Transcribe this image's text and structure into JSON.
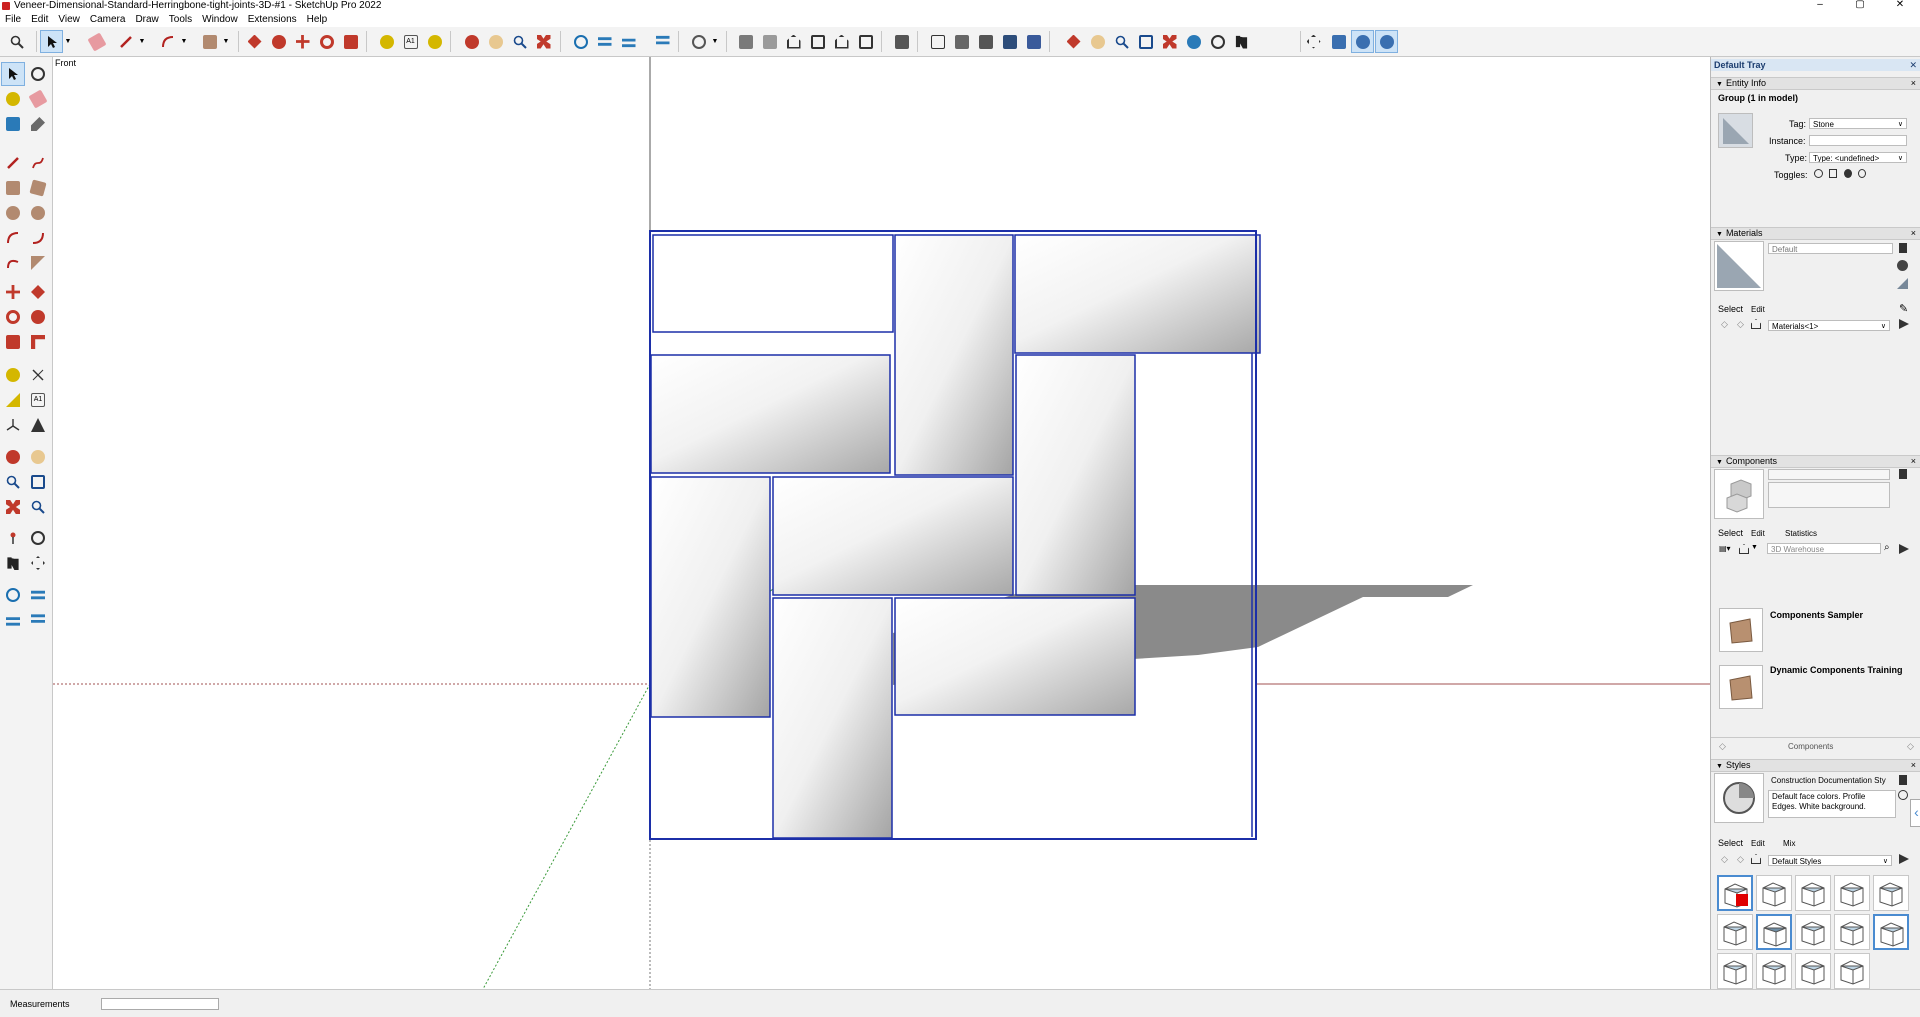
{
  "window": {
    "title": "Veneer-Dimensional-Standard-Herringbone-tight-joints-3D-#1 - SketchUp Pro 2022",
    "controls": [
      "–",
      "▢",
      "✕"
    ]
  },
  "menu": [
    "File",
    "Edit",
    "View",
    "Camera",
    "Draw",
    "Tools",
    "Window",
    "Extensions",
    "Help"
  ],
  "viewport": {
    "scene_label": "Front"
  },
  "tray": {
    "title": "Default Tray",
    "entity_info": {
      "header": "Entity Info",
      "selection": "Group (1 in model)",
      "tag_label": "Tag:",
      "tag_value": "Stone",
      "instance_label": "Instance:",
      "instance_value": "",
      "type_label": "Type:",
      "type_value": "Type: <undefined>",
      "toggles_label": "Toggles:"
    },
    "materials": {
      "header": "Materials",
      "name_field": "Default",
      "select_tab": "Select",
      "edit_tab": "Edit",
      "collection": "Materials<1>"
    },
    "components": {
      "header": "Components",
      "select_tab": "Select",
      "edit_tab": "Edit",
      "statistics_tab": "Statistics",
      "search_placeholder": "3D Warehouse",
      "items": [
        {
          "label": "Components Sampler"
        },
        {
          "label": "Dynamic Components Training"
        }
      ],
      "footer": "Components"
    },
    "styles": {
      "header": "Styles",
      "style_name": "Construction Documentation Sty",
      "style_desc": "Default face colors. Profile Edges. White background.",
      "select_tab": "Select",
      "edit_tab": "Edit",
      "mix_tab": "Mix",
      "collection": "Default Styles"
    }
  },
  "status": {
    "measurements_label": "Measurements",
    "measurements_value": ""
  },
  "colors": {
    "accent": "#4a8bd0",
    "selection": "#1c2fa8",
    "shadow": "#8a8a8a",
    "axis_red": "#a05050",
    "axis_green": "#3a9a3a"
  }
}
